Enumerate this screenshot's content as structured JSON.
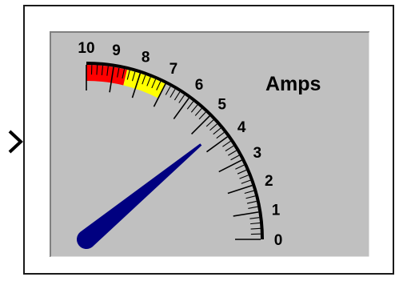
{
  "block": {
    "type": "gauge",
    "unit_label": "Amps",
    "scale_min": 0,
    "scale_max": 10,
    "major_labels": [
      "0",
      "1",
      "2",
      "3",
      "4",
      "5",
      "6",
      "7",
      "8",
      "9",
      "10"
    ],
    "minor_ticks_per_major": 5,
    "needle_value": 4.4,
    "bands": [
      {
        "name": "warning",
        "from": 7.0,
        "to": 8.5,
        "color": "#ffff00"
      },
      {
        "name": "danger",
        "from": 8.5,
        "to": 10.0,
        "color": "#ff0000"
      }
    ],
    "colors": {
      "face": "#c0c0c0",
      "needle": "#000080",
      "scale": "#000000",
      "frame": "#ffffff"
    },
    "input_port_icon": "chevron-right-icon"
  }
}
